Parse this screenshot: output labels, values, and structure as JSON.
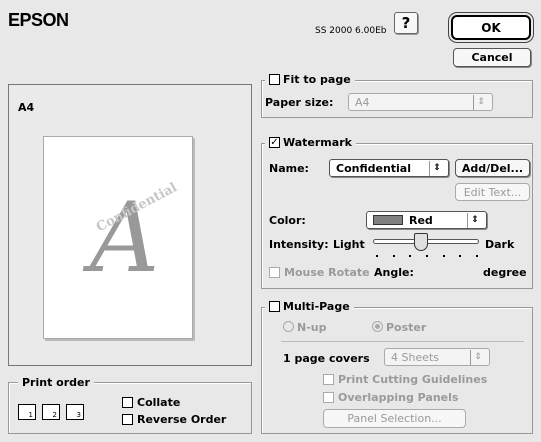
{
  "header": {
    "logo": "EPSON",
    "version": "SS 2000 6.00Eb",
    "help_label": "?",
    "ok_label": "OK",
    "cancel_label": "Cancel"
  },
  "preview": {
    "paper_label": "A4",
    "watermark_letter": "A",
    "watermark_text": "Confidential"
  },
  "fit_to_page": {
    "title": "Fit to page",
    "checked": false,
    "paper_size_label": "Paper size:",
    "paper_size_value": "A4"
  },
  "watermark": {
    "title": "Watermark",
    "checked": true,
    "name_label": "Name:",
    "name_value": "Confidential",
    "add_del_label": "Add/Del...",
    "edit_text_label": "Edit Text...",
    "color_label": "Color:",
    "color_value": "Red",
    "color_swatch": "#808080",
    "intensity_label": "Intensity:",
    "intensity_light": "Light",
    "intensity_dark": "Dark",
    "intensity_level": 0.45,
    "mouse_rotate_label": "Mouse Rotate",
    "angle_label": "Angle:",
    "degree_label": "degree"
  },
  "multi_page": {
    "title": "Multi-Page",
    "checked": false,
    "nup_label": "N-up",
    "poster_label": "Poster",
    "page_covers_label": "1 page covers",
    "page_covers_value": "4 Sheets",
    "print_cutting_label": "Print Cutting Guidelines",
    "overlapping_label": "Overlapping Panels",
    "panel_selection_label": "Panel Selection..."
  },
  "print_order": {
    "title": "Print order",
    "collate_label": "Collate",
    "reverse_label": "Reverse Order",
    "icons": [
      "1",
      "2",
      "3"
    ]
  }
}
